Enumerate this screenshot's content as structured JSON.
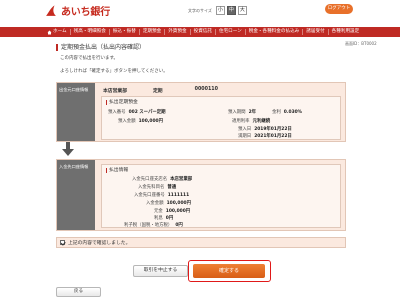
{
  "header": {
    "bank_name": "あいち銀行",
    "font_size_label": "文字のサイズ",
    "font_sizes": [
      "小",
      "中",
      "大"
    ],
    "logout_label": "ログアウト"
  },
  "nav": {
    "items": [
      "ホーム",
      "残高・明細照会",
      "振込・振替",
      "定期預金",
      "外貨預金",
      "投資信託",
      "住宅ローン",
      "税金・各種料金の払込み",
      "諸届受付",
      "各種利用設定"
    ]
  },
  "screen_id": "画面ID：BT0002",
  "page": {
    "title": "定期預金払出（払出内容確認）",
    "intro_line1": "この内容で払出を行います。",
    "intro_line2": "よろしければ「確定する」ボタンを押してください。"
  },
  "from_block": {
    "label": "出金元口座情報",
    "branch": "本店営業部",
    "account_type": "定期",
    "account_number": "0000110",
    "section_title": "払出定期預金",
    "fields": [
      {
        "key": "預入番号",
        "value": "002 スーパー定期"
      },
      {
        "key": "預入期間",
        "value": "2年"
      },
      {
        "key": "金利",
        "value": "0.030%"
      },
      {
        "key": "預入金額",
        "value": "100,000円"
      },
      {
        "key": "適用利率",
        "value": "元利継続"
      },
      {
        "key": "預入日",
        "value": "2019年01月22日"
      },
      {
        "key": "満期日",
        "value": "2021年01月22日"
      }
    ]
  },
  "to_block": {
    "label": "入金先口座情報",
    "section_title": "払出情報",
    "fields": [
      {
        "key": "入金先口座支店名",
        "value": "本店営業部"
      },
      {
        "key": "入金先科目名",
        "value": "普通"
      },
      {
        "key": "入金先口座番号",
        "value": "1111111"
      },
      {
        "key": "入金金額",
        "value": "100,000円"
      },
      {
        "key": "元金",
        "value": "100,000円"
      },
      {
        "key": "利息",
        "value": "0円"
      },
      {
        "key": "利子税（国税・地方税）",
        "value": "0円"
      }
    ]
  },
  "confirm": {
    "checkbox_label": "上記の内容で確認しました。",
    "checked": true
  },
  "buttons": {
    "cancel": "取引を中止する",
    "confirm": "確定する",
    "back": "戻る"
  },
  "colors": {
    "brand_red": "#bf2a24",
    "confirm_orange": "#e06a21",
    "panel_bg": "#fbe9df",
    "label_gray": "#6f6f6f"
  }
}
